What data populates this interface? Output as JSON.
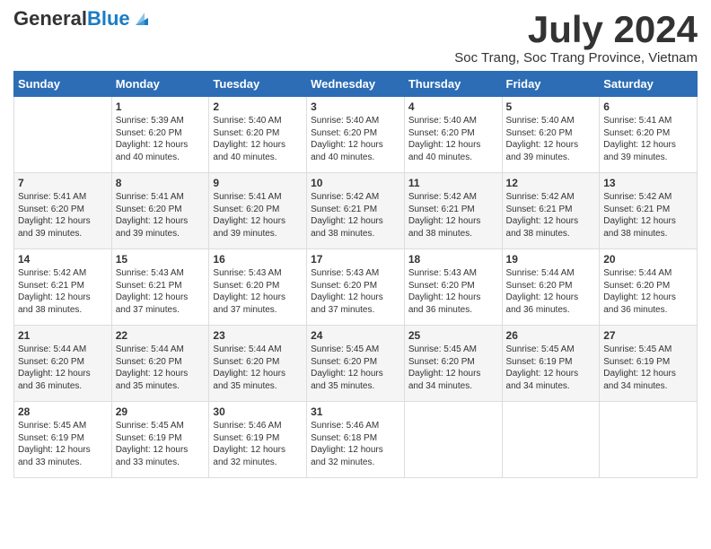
{
  "header": {
    "logo_general": "General",
    "logo_blue": "Blue",
    "month_title": "July 2024",
    "subtitle": "Soc Trang, Soc Trang Province, Vietnam"
  },
  "days_of_week": [
    "Sunday",
    "Monday",
    "Tuesday",
    "Wednesday",
    "Thursday",
    "Friday",
    "Saturday"
  ],
  "weeks": [
    [
      {
        "day": "",
        "text": ""
      },
      {
        "day": "1",
        "text": "Sunrise: 5:39 AM\nSunset: 6:20 PM\nDaylight: 12 hours\nand 40 minutes."
      },
      {
        "day": "2",
        "text": "Sunrise: 5:40 AM\nSunset: 6:20 PM\nDaylight: 12 hours\nand 40 minutes."
      },
      {
        "day": "3",
        "text": "Sunrise: 5:40 AM\nSunset: 6:20 PM\nDaylight: 12 hours\nand 40 minutes."
      },
      {
        "day": "4",
        "text": "Sunrise: 5:40 AM\nSunset: 6:20 PM\nDaylight: 12 hours\nand 40 minutes."
      },
      {
        "day": "5",
        "text": "Sunrise: 5:40 AM\nSunset: 6:20 PM\nDaylight: 12 hours\nand 39 minutes."
      },
      {
        "day": "6",
        "text": "Sunrise: 5:41 AM\nSunset: 6:20 PM\nDaylight: 12 hours\nand 39 minutes."
      }
    ],
    [
      {
        "day": "7",
        "text": "Sunrise: 5:41 AM\nSunset: 6:20 PM\nDaylight: 12 hours\nand 39 minutes."
      },
      {
        "day": "8",
        "text": "Sunrise: 5:41 AM\nSunset: 6:20 PM\nDaylight: 12 hours\nand 39 minutes."
      },
      {
        "day": "9",
        "text": "Sunrise: 5:41 AM\nSunset: 6:20 PM\nDaylight: 12 hours\nand 39 minutes."
      },
      {
        "day": "10",
        "text": "Sunrise: 5:42 AM\nSunset: 6:21 PM\nDaylight: 12 hours\nand 38 minutes."
      },
      {
        "day": "11",
        "text": "Sunrise: 5:42 AM\nSunset: 6:21 PM\nDaylight: 12 hours\nand 38 minutes."
      },
      {
        "day": "12",
        "text": "Sunrise: 5:42 AM\nSunset: 6:21 PM\nDaylight: 12 hours\nand 38 minutes."
      },
      {
        "day": "13",
        "text": "Sunrise: 5:42 AM\nSunset: 6:21 PM\nDaylight: 12 hours\nand 38 minutes."
      }
    ],
    [
      {
        "day": "14",
        "text": "Sunrise: 5:42 AM\nSunset: 6:21 PM\nDaylight: 12 hours\nand 38 minutes."
      },
      {
        "day": "15",
        "text": "Sunrise: 5:43 AM\nSunset: 6:21 PM\nDaylight: 12 hours\nand 37 minutes."
      },
      {
        "day": "16",
        "text": "Sunrise: 5:43 AM\nSunset: 6:20 PM\nDaylight: 12 hours\nand 37 minutes."
      },
      {
        "day": "17",
        "text": "Sunrise: 5:43 AM\nSunset: 6:20 PM\nDaylight: 12 hours\nand 37 minutes."
      },
      {
        "day": "18",
        "text": "Sunrise: 5:43 AM\nSunset: 6:20 PM\nDaylight: 12 hours\nand 36 minutes."
      },
      {
        "day": "19",
        "text": "Sunrise: 5:44 AM\nSunset: 6:20 PM\nDaylight: 12 hours\nand 36 minutes."
      },
      {
        "day": "20",
        "text": "Sunrise: 5:44 AM\nSunset: 6:20 PM\nDaylight: 12 hours\nand 36 minutes."
      }
    ],
    [
      {
        "day": "21",
        "text": "Sunrise: 5:44 AM\nSunset: 6:20 PM\nDaylight: 12 hours\nand 36 minutes."
      },
      {
        "day": "22",
        "text": "Sunrise: 5:44 AM\nSunset: 6:20 PM\nDaylight: 12 hours\nand 35 minutes."
      },
      {
        "day": "23",
        "text": "Sunrise: 5:44 AM\nSunset: 6:20 PM\nDaylight: 12 hours\nand 35 minutes."
      },
      {
        "day": "24",
        "text": "Sunrise: 5:45 AM\nSunset: 6:20 PM\nDaylight: 12 hours\nand 35 minutes."
      },
      {
        "day": "25",
        "text": "Sunrise: 5:45 AM\nSunset: 6:20 PM\nDaylight: 12 hours\nand 34 minutes."
      },
      {
        "day": "26",
        "text": "Sunrise: 5:45 AM\nSunset: 6:19 PM\nDaylight: 12 hours\nand 34 minutes."
      },
      {
        "day": "27",
        "text": "Sunrise: 5:45 AM\nSunset: 6:19 PM\nDaylight: 12 hours\nand 34 minutes."
      }
    ],
    [
      {
        "day": "28",
        "text": "Sunrise: 5:45 AM\nSunset: 6:19 PM\nDaylight: 12 hours\nand 33 minutes."
      },
      {
        "day": "29",
        "text": "Sunrise: 5:45 AM\nSunset: 6:19 PM\nDaylight: 12 hours\nand 33 minutes."
      },
      {
        "day": "30",
        "text": "Sunrise: 5:46 AM\nSunset: 6:19 PM\nDaylight: 12 hours\nand 32 minutes."
      },
      {
        "day": "31",
        "text": "Sunrise: 5:46 AM\nSunset: 6:18 PM\nDaylight: 12 hours\nand 32 minutes."
      },
      {
        "day": "",
        "text": ""
      },
      {
        "day": "",
        "text": ""
      },
      {
        "day": "",
        "text": ""
      }
    ]
  ]
}
